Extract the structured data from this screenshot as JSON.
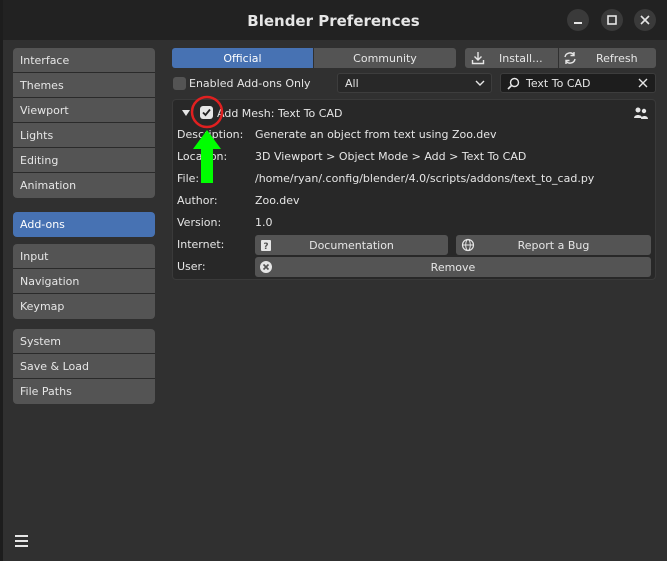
{
  "window": {
    "title": "Blender Preferences",
    "minimize_icon": "minimize-icon",
    "maximize_icon": "maximize-icon",
    "close_icon": "close-icon"
  },
  "sidebar": {
    "group1": [
      "Interface",
      "Themes",
      "Viewport",
      "Lights",
      "Editing",
      "Animation"
    ],
    "group2": [
      "Add-ons"
    ],
    "group3": [
      "Input",
      "Navigation",
      "Keymap"
    ],
    "group4": [
      "System",
      "Save & Load",
      "File Paths"
    ],
    "active": "Add-ons"
  },
  "toolbar": {
    "tab_official": "Official",
    "tab_community": "Community",
    "install_label": "Install...",
    "refresh_label": "Refresh",
    "enabled_only_label": "Enabled Add-ons Only",
    "category_value": "All",
    "search_value": "Text To CAD"
  },
  "addon": {
    "name": "Add Mesh: Text To CAD",
    "enabled": true,
    "labels": {
      "description": "Description:",
      "location": "Location:",
      "file": "File:",
      "author": "Author:",
      "version": "Version:",
      "internet": "Internet:",
      "user": "User:"
    },
    "description": "Generate an object from text using Zoo.dev",
    "location": "3D Viewport > Object Mode > Add > Text To CAD",
    "file": "/home/ryan/.config/blender/4.0/scripts/addons/text_to_cad.py",
    "author": "Zoo.dev",
    "version": "1.0",
    "documentation_label": "Documentation",
    "report_bug_label": "Report a Bug",
    "remove_label": "Remove"
  },
  "colors": {
    "accent": "#4772b3",
    "annotation_circle": "#e02020",
    "annotation_arrow": "#00ff00"
  }
}
